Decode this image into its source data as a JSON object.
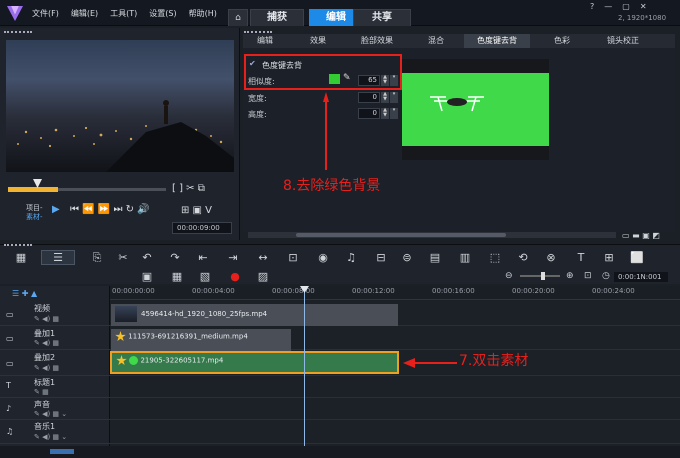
{
  "menu": [
    "文件(F)",
    "编辑(E)",
    "工具(T)",
    "设置(S)",
    "帮助(H)"
  ],
  "tabs": {
    "capture": "捕获",
    "edit": "编辑",
    "share": "共享"
  },
  "resolution": "2, 1920*1080",
  "player": {
    "project_label": "项目-",
    "clip_label": "素材-",
    "timecode": "00:00:09:00"
  },
  "option_tabs": [
    "编辑",
    "效果",
    "脸部效果",
    "混合",
    "色度键去背",
    "色彩",
    "镜头校正"
  ],
  "chroma": {
    "enable_label": "色度键去背",
    "similarity_label": "相似度:",
    "similarity_value": "65",
    "width_label": "宽度:",
    "width_value": "0",
    "height_label": "高度:",
    "height_value": "0",
    "key_color": "#33cc33"
  },
  "annotations": {
    "step8": "8.去除绿色背景",
    "step7": "7.双击素材"
  },
  "timeline": {
    "ruler": [
      "00:00:00:00",
      "00:00:04:00",
      "00:00:08:00",
      "00:00:12:00",
      "00:00:16:00",
      "00:00:20:00",
      "00:00:24:00"
    ],
    "zoom_time": "0:00:1N:001",
    "tracks": [
      "视频",
      "叠加1",
      "叠加2",
      "标题1",
      "声音",
      "音乐1"
    ],
    "clips": [
      "4596414-hd_1920_1080_25fps.mp4",
      "111573-691216391_medium.mp4",
      "21905-322605117.mp4"
    ]
  }
}
